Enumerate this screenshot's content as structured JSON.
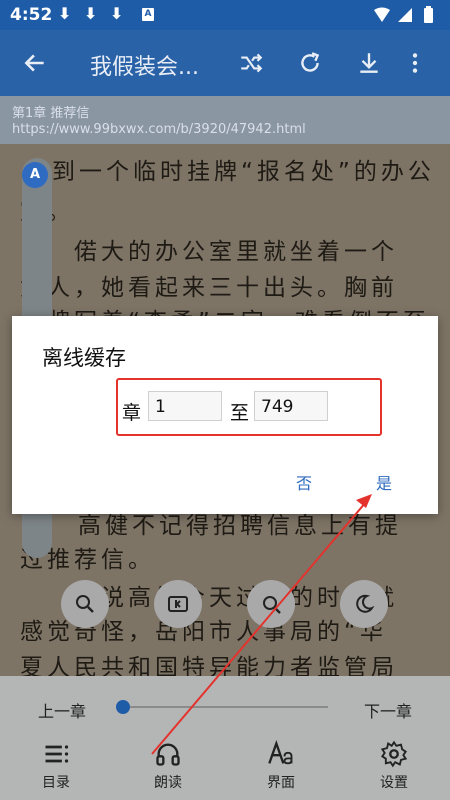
{
  "status_bar": {
    "time": "4:52",
    "download_glyph": "⬇",
    "a_badge": "A"
  },
  "app_bar": {
    "title": "我假装会..."
  },
  "reader": {
    "chapter": "第1章 推荐信",
    "url": "https://www.99bxwx.com/b/3920/47942.html",
    "lines": [
      "到一个临时挂牌“报名处”的办公",
      "室。",
      "　　偌大的办公室里就坐着一个",
      "女人，她看起来三十出头。胸前",
      "工牌写着“李柔”二字。难看倒不至",
      "高健不记得招聘信息上有提",
      "过推荐信。",
      "　　要说高健今天过来的时候就",
      "感觉奇怪，岳阳市人事局的“华",
      "夏人民共和国特异能力者监管局"
    ],
    "side_badge": "A"
  },
  "dialog": {
    "title": "离线缓存",
    "chapter_label": "章",
    "from_value": "1",
    "to_label": "至",
    "to_value": "749",
    "no_label": "否",
    "yes_label": "是"
  },
  "bottom": {
    "prev_label": "上一章",
    "next_label": "下一章",
    "progress": 0,
    "nav": [
      {
        "label": "目录",
        "icon": "menu-list-icon"
      },
      {
        "label": "朗读",
        "icon": "headphones-icon"
      },
      {
        "label": "界面",
        "icon": "font-aa-icon"
      },
      {
        "label": "设置",
        "icon": "gear-icon"
      }
    ]
  },
  "colors": {
    "accent": "#2962a7",
    "highlight": "#e4322d",
    "button_text": "#2f6bc0"
  }
}
